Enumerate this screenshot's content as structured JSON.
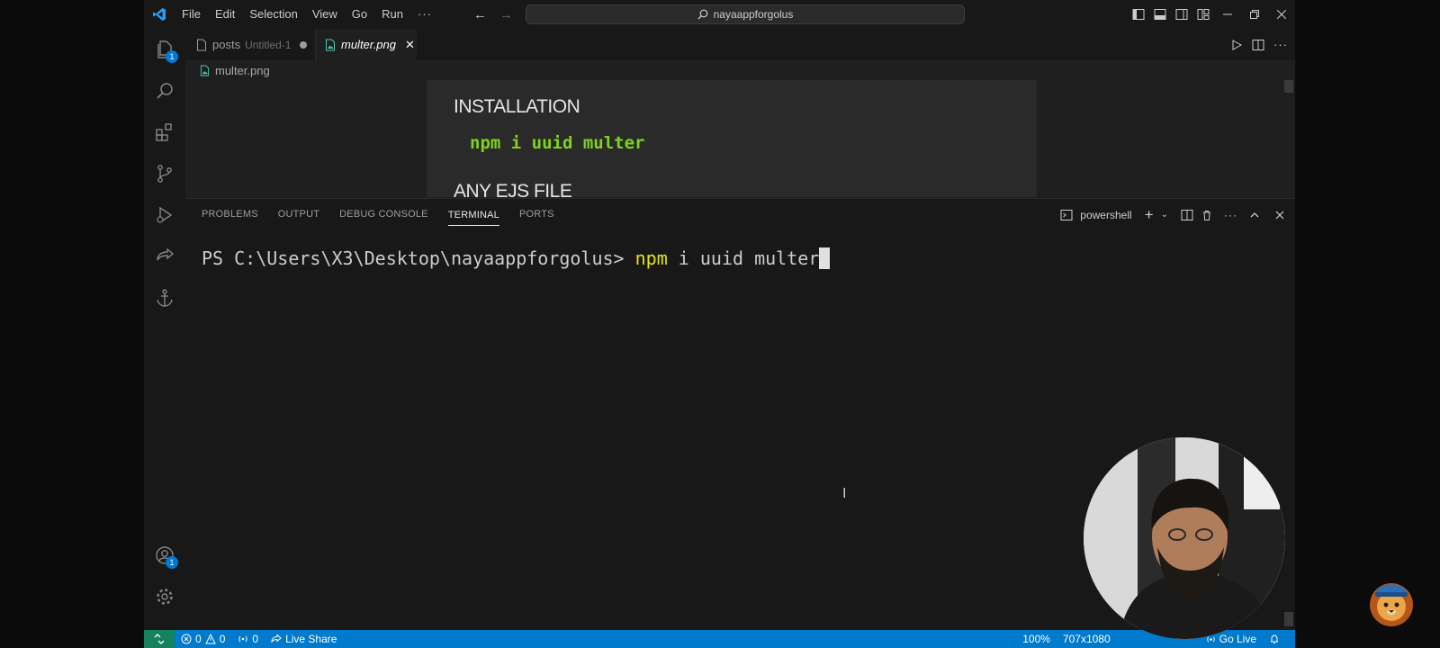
{
  "titlebar": {
    "menu": [
      "File",
      "Edit",
      "Selection",
      "View",
      "Go",
      "Run"
    ],
    "more": "···",
    "search": "nayaappforgolus"
  },
  "activitybar": {
    "explorer_badge": "1",
    "accounts_badge": "1"
  },
  "tabs": [
    {
      "name": "posts",
      "detail": "Untitled-1"
    },
    {
      "name": "multer.png"
    }
  ],
  "breadcrumb": "multer.png",
  "image_preview": {
    "heading1": "INSTALLATION",
    "command": "npm i uuid multer",
    "heading2": "ANY EJS FILE"
  },
  "panel": {
    "tabs": [
      "PROBLEMS",
      "OUTPUT",
      "DEBUG CONSOLE",
      "TERMINAL",
      "PORTS"
    ],
    "active_tab": "TERMINAL",
    "shell": "powershell"
  },
  "terminal": {
    "prompt": "PS C:\\Users\\X3\\Desktop\\nayaappforgolus> ",
    "command": "npm",
    "args": " i uuid multer"
  },
  "statusbar": {
    "errors": "0",
    "warnings": "0",
    "ports": "0",
    "live_share": "Live Share",
    "zoom": "100%",
    "dimensions": "707x1080",
    "go_live": "Go Live"
  },
  "colors": {
    "accent": "#007acc",
    "remote": "#16825d",
    "terminal_cmd": "#e5e510",
    "image_code": "#7ed321"
  }
}
